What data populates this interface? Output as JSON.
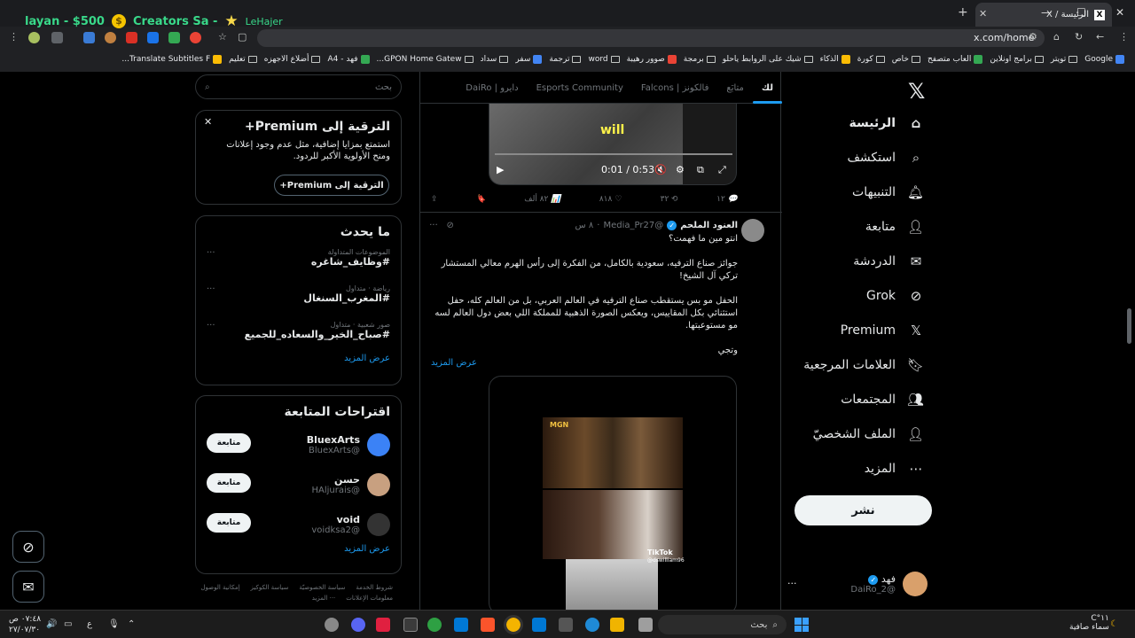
{
  "browser": {
    "tab_title": "الرئيسة / X",
    "url": "x.com/home",
    "stream_overlay": {
      "user": "layan - $500",
      "channel": "Creators Sa -",
      "host": "LeHajer"
    },
    "bookmarks": [
      "Google",
      "تويتر",
      "برامج اونلاين",
      "العاب متصفح",
      "خاص",
      "كورة",
      "الذكاء",
      "شيك على الروابط ياحلو",
      "برمجة",
      "صوور رهيبة",
      "word",
      "ترجمة",
      "سفر",
      "سداد",
      "GPON Home Gatew...",
      "فهد - A4",
      "أضلاع الاجهزه",
      "تعليم",
      "Translate Subtitles F..."
    ]
  },
  "nav": {
    "items": [
      {
        "label": "الرئيسة",
        "icon": "home-icon"
      },
      {
        "label": "استكشف",
        "icon": "search-icon"
      },
      {
        "label": "التنبيهات",
        "icon": "bell-icon"
      },
      {
        "label": "متابعة",
        "icon": "add-user-icon"
      },
      {
        "label": "الدردشة",
        "icon": "mail-icon"
      },
      {
        "label": "Grok",
        "icon": "grok-icon"
      },
      {
        "label": "Premium",
        "icon": "x-icon"
      },
      {
        "label": "العلامات المرجعية",
        "icon": "bookmark-icon"
      },
      {
        "label": "المجتمعات",
        "icon": "communities-icon"
      },
      {
        "label": "الملف الشخصيّ",
        "icon": "profile-icon"
      },
      {
        "label": "المزيد",
        "icon": "more-icon"
      }
    ],
    "post_label": "نشر",
    "account": {
      "name": "فهد",
      "handle": "@DaiRo_2",
      "more": "..."
    }
  },
  "feed": {
    "tabs": [
      "لك",
      "متابَع",
      "فالكونز | Falcons",
      "Esports Community",
      "دايرو | DaiRo"
    ],
    "video1": {
      "caption": "will",
      "time": "0:01 / 0:53"
    },
    "post1_actions": {
      "replies": "١٢",
      "reposts": "٣٢",
      "likes": "٨١٨",
      "views": "٨٢ ألف"
    },
    "post2": {
      "name": "العنود الملحم",
      "handle": "@Media_Pr27",
      "time": "٨ س",
      "paragraphs": [
        "انتو مين ما فهمت؟",
        "جوائز صناع الترفيه، سعودية بالكامل، من الفكرة إلى رأس الهرم معالي المستشار تركي آل الشيخ!",
        "الحفل مو بس يستقطب صناع الترفيه في العالم العربي، بل من العالم كله، حفل استثنائي بكل المقاييس، ويعكس الصورة الذهبية للمملكة اللي بعض دول العالم لسه مو مستوعبتها.",
        "وتجي"
      ],
      "show_more": "عرض المزيد",
      "media": {
        "logo": "MGN",
        "tiktok": "TikTok",
        "tiktok_handle": "@dswilliam96",
        "time": "0:00"
      }
    }
  },
  "sidebar": {
    "search_placeholder": "بحث",
    "premium": {
      "title": "اشترك في Premium+",
      "title_display": "الترقية إلى Premium+",
      "text": "استمتع بمزايا إضافية، مثل عدم وجود إعلانات ومنح الأولوية الأكبر للردود.",
      "button": "الترقية إلى Premium+"
    },
    "trends": {
      "title": "ما يحدث",
      "items": [
        {
          "category": "الموضوعات المتداولة",
          "tag": "#وظايف_شاغره"
        },
        {
          "category": "رياضة · متداول",
          "tag": "#المغرب_السنغال"
        },
        {
          "category": "صور شعبية · متداول",
          "tag": "#صباح_الخير_والسعاده_للجميع"
        }
      ],
      "show_more": "عرض المزيد"
    },
    "follow": {
      "title": "اقتراحات المتابعة",
      "users": [
        {
          "name": "BluexArts",
          "handle": "@BluexArts",
          "button": "متابعة"
        },
        {
          "name": "حسن",
          "handle": "@HAljurais",
          "button": "متابعة"
        },
        {
          "name": "void",
          "handle": "@voidksa2",
          "button": "متابعة"
        }
      ],
      "show_more": "عرض المزيد"
    },
    "footer": [
      "شروط الخدمة",
      "سياسة الخصوصيّة",
      "سياسة الكوكيز",
      "إمكانية الوصول",
      "معلومات الإعلانات",
      "··· المزيد"
    ]
  },
  "taskbar": {
    "search_placeholder": "بحث",
    "weather": {
      "temp": "١١°C",
      "desc": "سماء صافية"
    },
    "clock": {
      "time": "٠٧:٤٨ ص",
      "date": "٢٧/٠٧/٣٠"
    },
    "lang": "ع"
  }
}
